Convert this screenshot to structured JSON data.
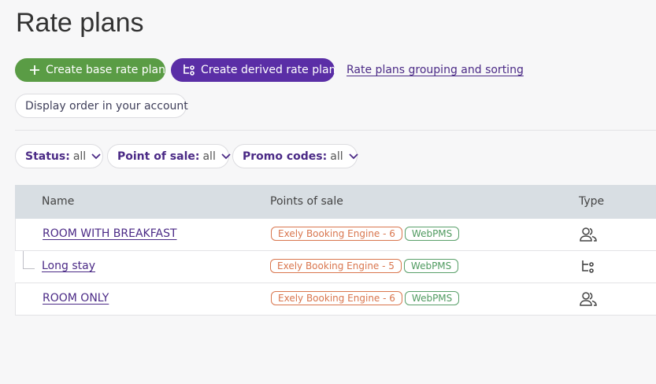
{
  "page": {
    "title": "Rate plans"
  },
  "actions": {
    "create_base": "Create base rate plan",
    "create_derived": "Create derived rate plan",
    "grouping_link": "Rate plans grouping and sorting",
    "display_order": "Display order in your account"
  },
  "filters": [
    {
      "label": "Status:",
      "value": "all"
    },
    {
      "label": "Point of sale:",
      "value": "all"
    },
    {
      "label": "Promo codes:",
      "value": "all"
    }
  ],
  "table": {
    "columns": [
      "Name",
      "Points of sale",
      "Type"
    ],
    "rows": [
      {
        "name": "ROOM WITH BREAKFAST",
        "engine": "Exely Booking Engine - 6",
        "pms": "WebPMS",
        "type_icon": "users-icon"
      },
      {
        "name": "Long stay",
        "engine": "Exely Booking Engine - 5",
        "pms": "WebPMS",
        "type_icon": "derived-icon"
      },
      {
        "name": "ROOM ONLY",
        "engine": "Exely Booking Engine - 6",
        "pms": "WebPMS",
        "type_icon": "users-icon"
      }
    ]
  },
  "colors": {
    "primary_green": "#5a9c45",
    "primary_purple": "#5a2ea6",
    "link": "#4b2a86",
    "engine_badge": "#d9764e",
    "pms_badge": "#5aa06a"
  }
}
